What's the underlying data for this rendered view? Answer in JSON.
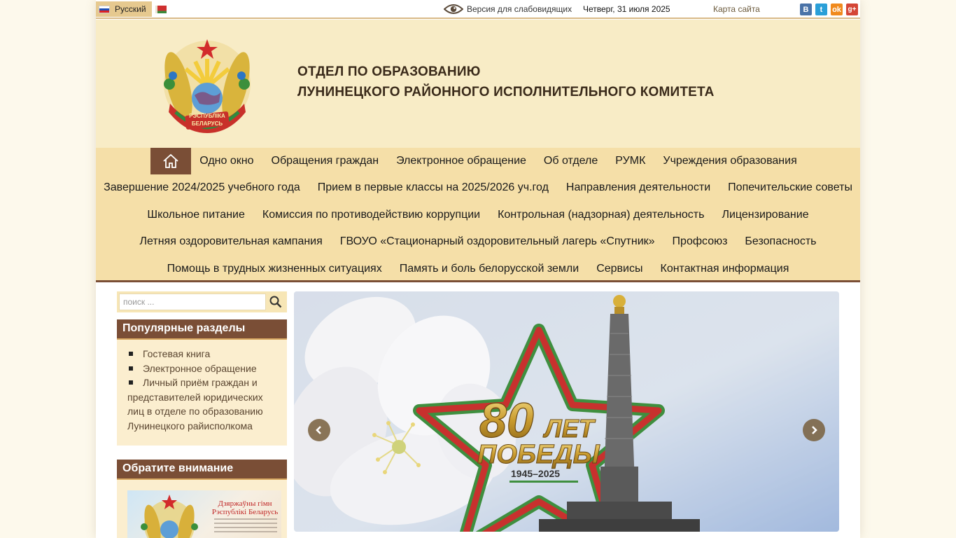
{
  "topbar": {
    "lang_ru": "Русский",
    "low_vision": "Версия для слабовидящих",
    "date": "Четверг, 31 июля 2025",
    "sitemap": "Карта сайта",
    "social": [
      "В",
      "t",
      "ok",
      "g+"
    ]
  },
  "header": {
    "title_line1": "ОТДЕЛ ПО ОБРАЗОВАНИЮ",
    "title_line2": "ЛУНИНЕЦКОГО РАЙОННОГО ИСПОЛНИТЕЛЬНОГО КОМИТЕТА",
    "emblem_text_1": "РЭСПУБЛІКА",
    "emblem_text_2": "БЕЛАРУСЬ"
  },
  "nav": {
    "home_icon": "home-icon",
    "rows": [
      [
        "Одно окно",
        "Обращения граждан",
        "Электронное обращение",
        "Об отделе",
        "РУМК",
        "Учреждения образования"
      ],
      [
        "Завершение 2024/2025 учебного года",
        "Прием в первые классы на 2025/2026 уч.год",
        "Направления деятельности",
        "Попечительские советы"
      ],
      [
        "Школьное питание",
        "Комиссия по противодействию коррупции",
        "Контрольная (надзорная) деятельность",
        "Лицензирование"
      ],
      [
        "Летняя оздоровительная кампания",
        "ГВОУО «Стационарный оздоровительный лагерь «Спутник»",
        "Профсоюз",
        "Безопасность"
      ],
      [
        "Помощь в трудных жизненных ситуациях",
        "Память и боль белорусской земли",
        "Сервисы",
        "Контактная информация"
      ]
    ]
  },
  "search": {
    "placeholder": "поиск ..."
  },
  "popular": {
    "title": "Популярные разделы",
    "items": [
      "Гостевая книга",
      "Электронное обращение",
      "Личный приём граждан и представителей юридических лиц в отделе по образованию Лунинецкого райисполкома"
    ]
  },
  "notice": {
    "title": "Обратите внимание",
    "anthem_title": "Дзяржаўны гімн Рэспублікі Беларусь"
  },
  "slider": {
    "big_number": "80",
    "word_let": "ЛЕТ",
    "word_pobedy": "ПОБЕДЫ",
    "years": "1945–2025"
  },
  "colors": {
    "brown": "#7a4e36",
    "nav_bg": "#f5dfa8",
    "header_bg": "#f8ecc6"
  }
}
